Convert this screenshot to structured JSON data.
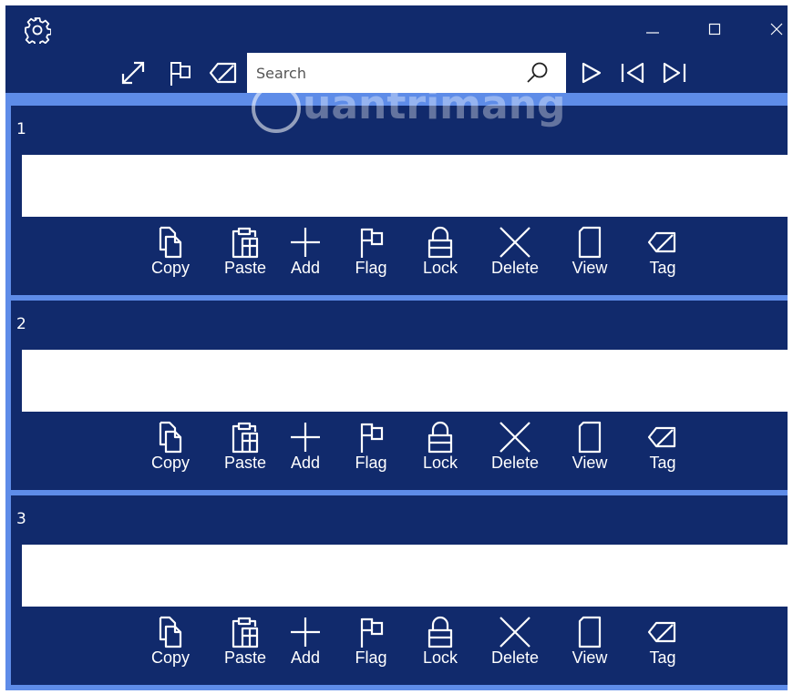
{
  "window": {
    "controls": {
      "minimize": "minimize-icon",
      "maximize": "maximize-icon",
      "close": "close-icon"
    },
    "settings_icon": "gear-icon"
  },
  "toolbar": {
    "icons": [
      "expand-icon",
      "flag-icon",
      "tag-icon"
    ],
    "search": {
      "placeholder": "Search",
      "value": ""
    },
    "nav_icons": [
      "play-icon",
      "skip-first-icon",
      "skip-last-icon"
    ]
  },
  "watermark": {
    "text": "uantrimang"
  },
  "panels": [
    {
      "number": "1",
      "text": ""
    },
    {
      "number": "2",
      "text": ""
    },
    {
      "number": "3",
      "text": ""
    }
  ],
  "actions": [
    {
      "label": "Copy",
      "icon": "copy-icon"
    },
    {
      "label": "Paste",
      "icon": "paste-icon"
    },
    {
      "label": "Add",
      "icon": "plus-icon"
    },
    {
      "label": "Flag",
      "icon": "flag-icon"
    },
    {
      "label": "Lock",
      "icon": "lock-icon"
    },
    {
      "label": "Delete",
      "icon": "close-icon"
    },
    {
      "label": "View",
      "icon": "view-icon"
    },
    {
      "label": "Tag",
      "icon": "tag-icon"
    }
  ],
  "colors": {
    "background": "#112a6c",
    "divider": "#5e8ce8",
    "field": "#ffffff",
    "text": "#ffffff"
  }
}
